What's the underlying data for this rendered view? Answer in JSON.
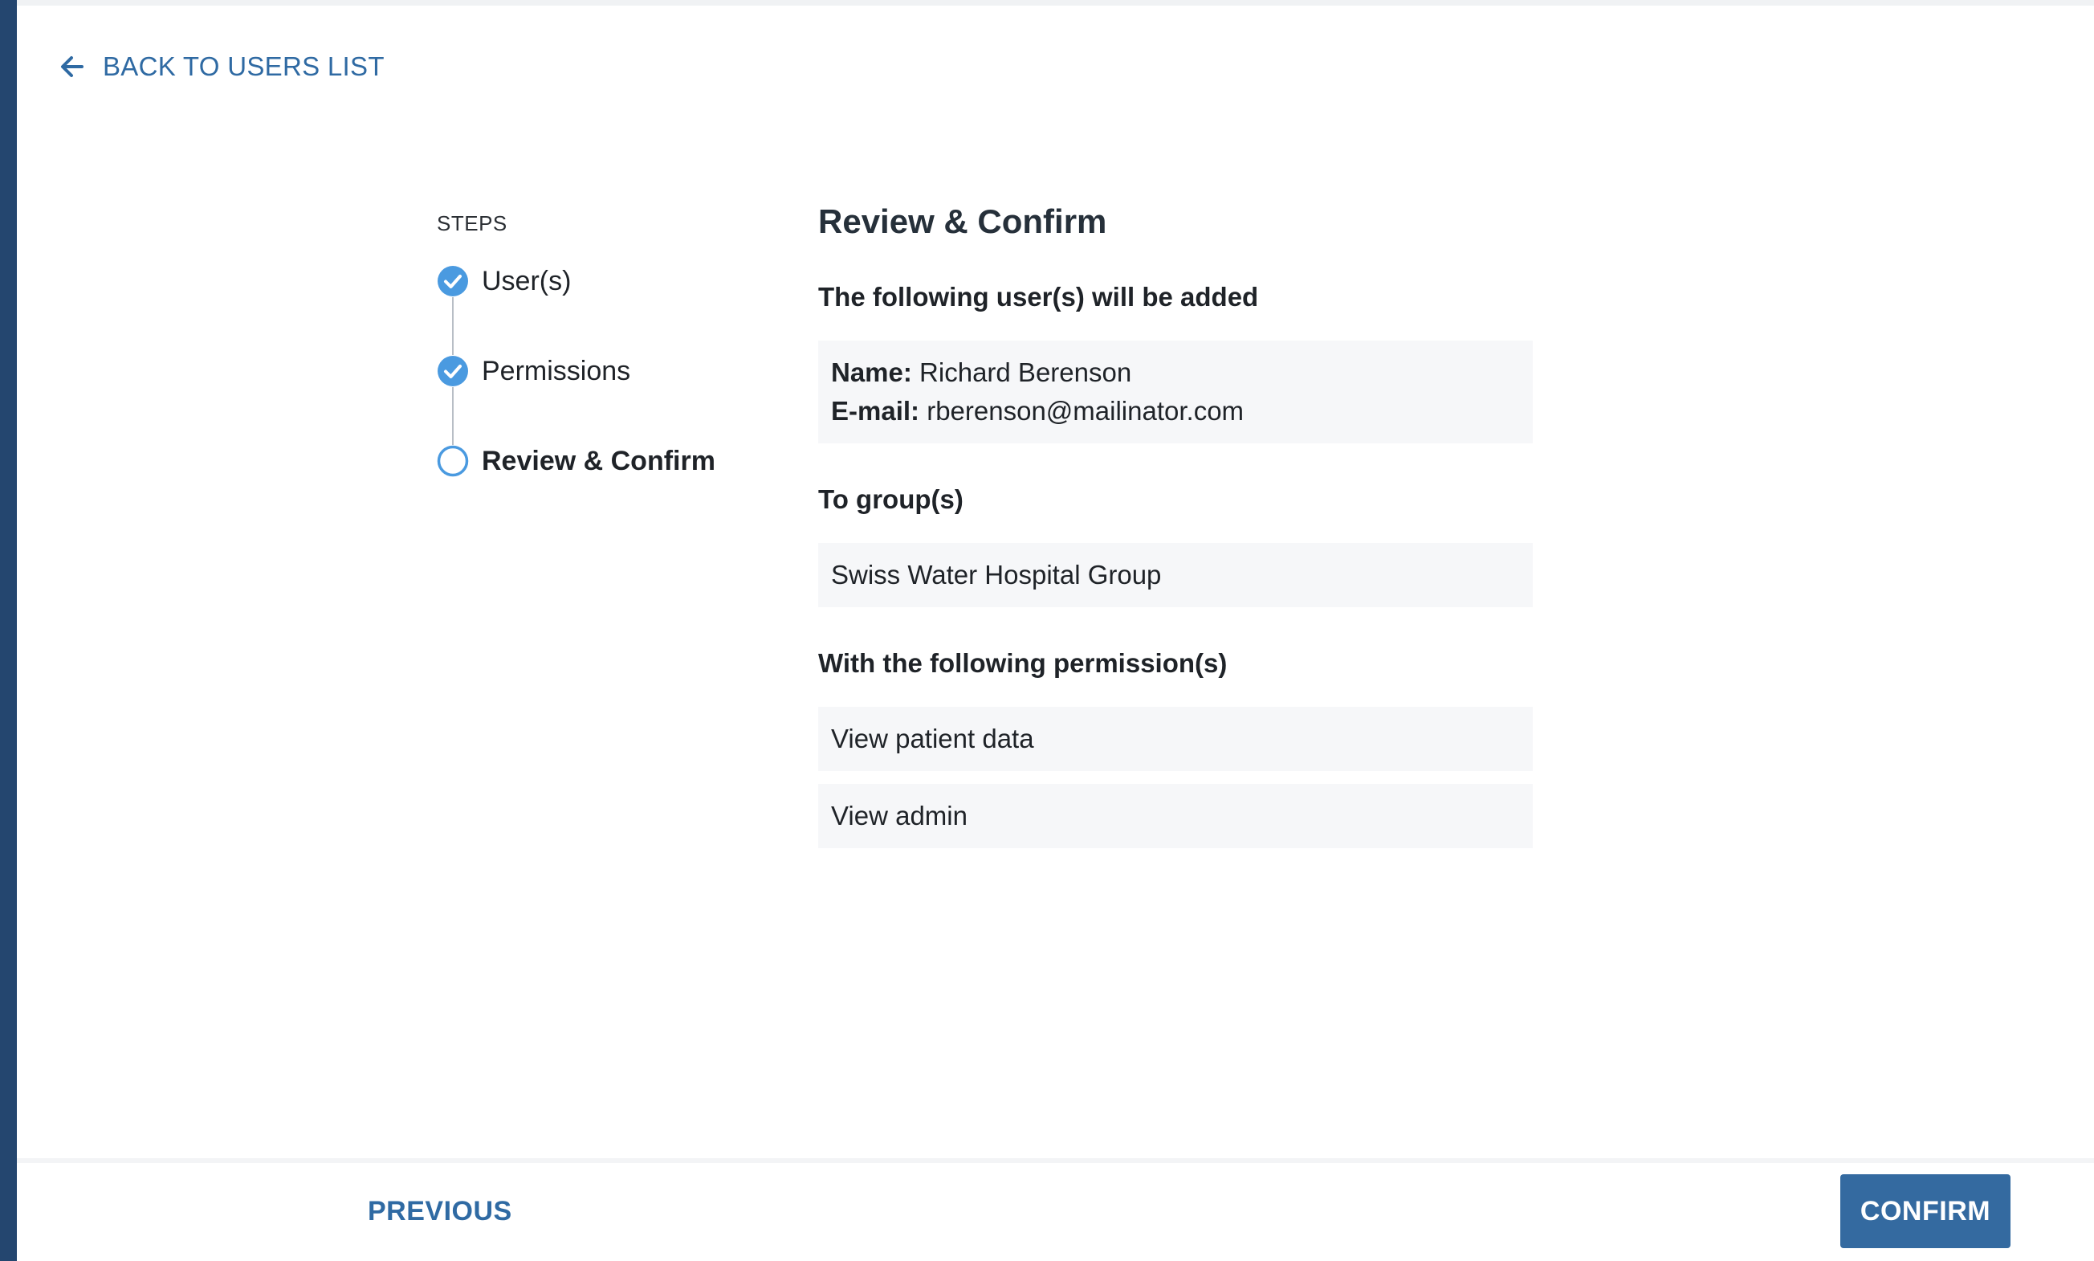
{
  "nav": {
    "back_label": "BACK TO USERS LIST",
    "back_icon": "arrow-left-icon"
  },
  "stepper": {
    "title": "STEPS",
    "steps": [
      {
        "label": "User(s)",
        "status": "completed",
        "icon": "check-circle-icon"
      },
      {
        "label": "Permissions",
        "status": "completed",
        "icon": "check-circle-icon"
      },
      {
        "label": "Review & Confirm",
        "status": "current",
        "icon": "circle-outline-icon"
      }
    ]
  },
  "review": {
    "title": "Review & Confirm",
    "users_heading": "The following user(s) will be added",
    "user": {
      "name_label": "Name:",
      "name_value": "Richard Berenson",
      "email_label": "E-mail:",
      "email_value": "rberenson@mailinator.com"
    },
    "groups_heading": "To group(s)",
    "groups": [
      "Swiss Water Hospital Group"
    ],
    "permissions_heading": "With the following permission(s)",
    "permissions": [
      "View patient data",
      "View admin"
    ]
  },
  "footer": {
    "previous_label": "PREVIOUS",
    "confirm_label": "CONFIRM"
  },
  "colors": {
    "rail": "#24466f",
    "link": "#2f6aa3",
    "accent": "#4a9ae0",
    "primary_button": "#346aa0",
    "card_bg": "#f6f7f9"
  }
}
